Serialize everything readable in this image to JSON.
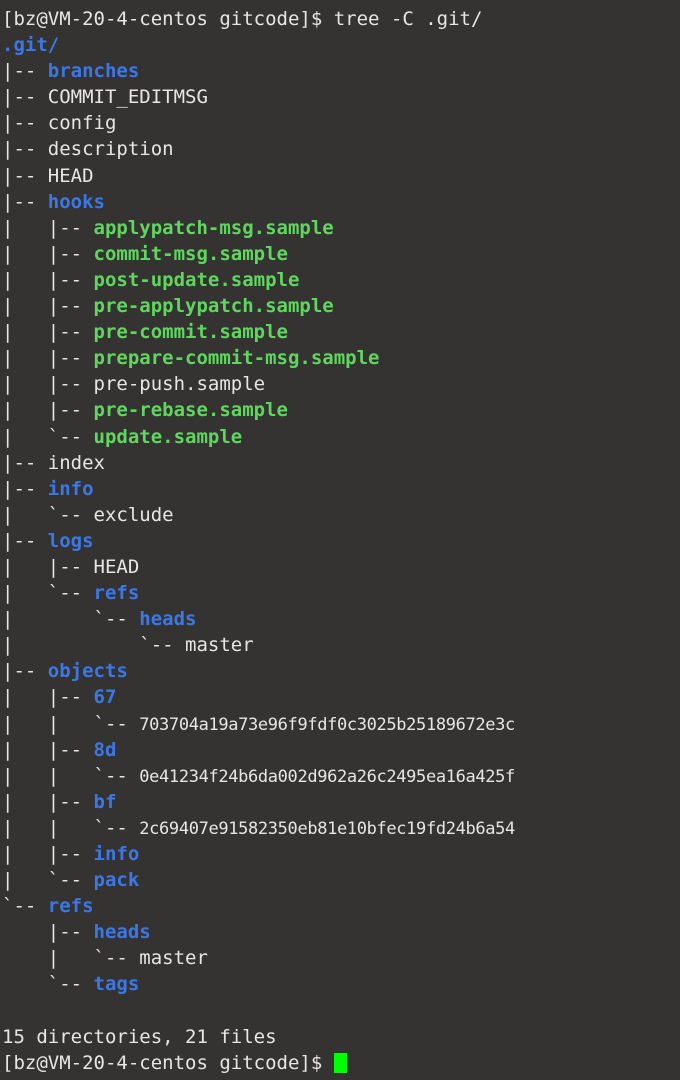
{
  "terminal": {
    "background_color": "#353331",
    "foreground_color": "#e6e6e6",
    "directory_color": "#3b78e7",
    "executable_color": "#5fd75f",
    "cursor_color": "#00ff00",
    "command_line": "[bz@VM-20-4-centos gitcode]$ tree -C .git/",
    "prompt_line": "[bz@VM-20-4-centos gitcode]$ ",
    "summary": "15 directories, 21 files",
    "root": ".git/",
    "lines": [
      {
        "prefix": "",
        "name": ".git/",
        "type": "dir"
      },
      {
        "prefix": "|-- ",
        "name": "branches",
        "type": "dir"
      },
      {
        "prefix": "|-- ",
        "name": "COMMIT_EDITMSG",
        "type": "file"
      },
      {
        "prefix": "|-- ",
        "name": "config",
        "type": "file"
      },
      {
        "prefix": "|-- ",
        "name": "description",
        "type": "file"
      },
      {
        "prefix": "|-- ",
        "name": "HEAD",
        "type": "file"
      },
      {
        "prefix": "|-- ",
        "name": "hooks",
        "type": "dir"
      },
      {
        "prefix": "|   |-- ",
        "name": "applypatch-msg.sample",
        "type": "exe"
      },
      {
        "prefix": "|   |-- ",
        "name": "commit-msg.sample",
        "type": "exe"
      },
      {
        "prefix": "|   |-- ",
        "name": "post-update.sample",
        "type": "exe"
      },
      {
        "prefix": "|   |-- ",
        "name": "pre-applypatch.sample",
        "type": "exe"
      },
      {
        "prefix": "|   |-- ",
        "name": "pre-commit.sample",
        "type": "exe"
      },
      {
        "prefix": "|   |-- ",
        "name": "prepare-commit-msg.sample",
        "type": "exe"
      },
      {
        "prefix": "|   |-- ",
        "name": "pre-push.sample",
        "type": "file"
      },
      {
        "prefix": "|   |-- ",
        "name": "pre-rebase.sample",
        "type": "exe"
      },
      {
        "prefix": "|   `-- ",
        "name": "update.sample",
        "type": "exe"
      },
      {
        "prefix": "|-- ",
        "name": "index",
        "type": "file"
      },
      {
        "prefix": "|-- ",
        "name": "info",
        "type": "dir"
      },
      {
        "prefix": "|   `-- ",
        "name": "exclude",
        "type": "file"
      },
      {
        "prefix": "|-- ",
        "name": "logs",
        "type": "dir"
      },
      {
        "prefix": "|   |-- ",
        "name": "HEAD",
        "type": "file"
      },
      {
        "prefix": "|   `-- ",
        "name": "refs",
        "type": "dir"
      },
      {
        "prefix": "|       `-- ",
        "name": "heads",
        "type": "dir"
      },
      {
        "prefix": "|           `-- ",
        "name": "master",
        "type": "file"
      },
      {
        "prefix": "|-- ",
        "name": "objects",
        "type": "dir"
      },
      {
        "prefix": "|   |-- ",
        "name": "67",
        "type": "dir"
      },
      {
        "prefix": "|   |   `-- ",
        "name": "703704a19a73e96f9fdf0c3025b25189672e3c",
        "type": "hash"
      },
      {
        "prefix": "|   |-- ",
        "name": "8d",
        "type": "dir"
      },
      {
        "prefix": "|   |   `-- ",
        "name": "0e41234f24b6da002d962a26c2495ea16a425f",
        "type": "hash"
      },
      {
        "prefix": "|   |-- ",
        "name": "bf",
        "type": "dir"
      },
      {
        "prefix": "|   |   `-- ",
        "name": "2c69407e91582350eb81e10bfec19fd24b6a54",
        "type": "hash"
      },
      {
        "prefix": "|   |-- ",
        "name": "info",
        "type": "dir"
      },
      {
        "prefix": "|   `-- ",
        "name": "pack",
        "type": "dir"
      },
      {
        "prefix": "`-- ",
        "name": "refs",
        "type": "dir"
      },
      {
        "prefix": "    |-- ",
        "name": "heads",
        "type": "dir"
      },
      {
        "prefix": "    |   `-- ",
        "name": "master",
        "type": "file"
      },
      {
        "prefix": "    `-- ",
        "name": "tags",
        "type": "dir"
      }
    ]
  }
}
